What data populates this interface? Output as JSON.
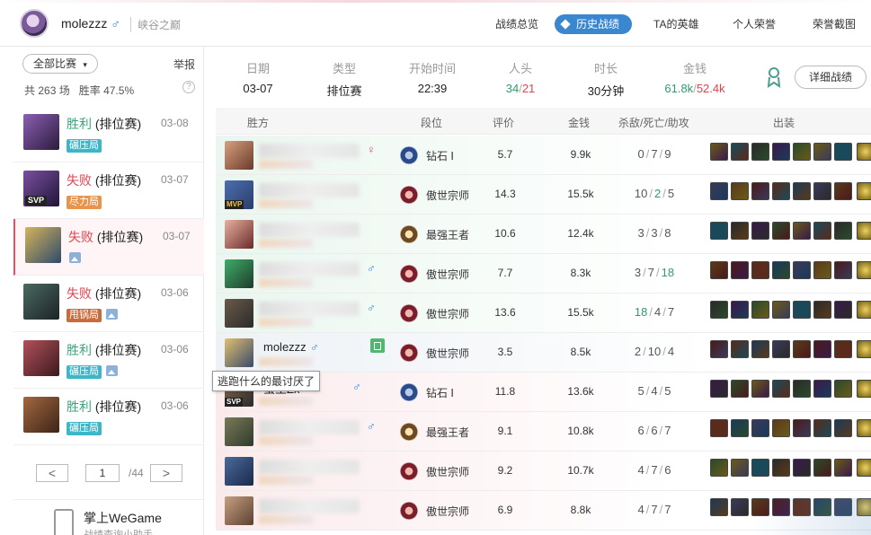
{
  "header": {
    "username": "molezzz",
    "gender_symbol": "♂",
    "server": "峡谷之巅",
    "nav": [
      "战绩总览",
      "历史战绩",
      "TA的英雄",
      "个人荣誉",
      "荣誉截图"
    ],
    "active_nav": "历史战绩"
  },
  "sidebar": {
    "filter_label": "全部比赛",
    "report_label": "举报",
    "total_prefix": "共",
    "total_games": "263",
    "total_suffix": "场",
    "winrate_label": "胜率",
    "winrate": "47.5%",
    "help": "?",
    "matches": [
      {
        "result": "胜利",
        "type": "(排位赛)",
        "date": "03-08",
        "tag": "碾压局",
        "tag_color": "#3cb6c8",
        "win": true,
        "pic": false,
        "svp": false
      },
      {
        "result": "失败",
        "type": "(排位赛)",
        "date": "03-07",
        "tag": "尽力局",
        "tag_color": "#e8944a",
        "win": false,
        "pic": false,
        "svp": true,
        "svp_label": "SVP"
      },
      {
        "result": "失败",
        "type": "(排位赛)",
        "date": "03-07",
        "tag": "",
        "tag_color": "",
        "win": false,
        "pic": true,
        "svp": false
      },
      {
        "result": "失败",
        "type": "(排位赛)",
        "date": "03-06",
        "tag": "甩锅局",
        "tag_color": "#c96b3b",
        "win": false,
        "pic": true,
        "svp": false
      },
      {
        "result": "胜利",
        "type": "(排位赛)",
        "date": "03-06",
        "tag": "碾压局",
        "tag_color": "#3cb6c8",
        "win": true,
        "pic": true,
        "svp": false
      },
      {
        "result": "胜利",
        "type": "(排位赛)",
        "date": "03-06",
        "tag": "碾压局",
        "tag_color": "#3cb6c8",
        "win": true,
        "pic": false,
        "svp": false
      }
    ],
    "pager": {
      "prev": "<",
      "current": "1",
      "total": "/44",
      "next": ">"
    },
    "mobile": {
      "title": "掌上WeGame",
      "subtitle": "战绩查询小助手"
    }
  },
  "summary": {
    "date_label": "日期",
    "date": "03-07",
    "type_label": "类型",
    "type": "排位赛",
    "start_label": "开始时间",
    "start": "22:39",
    "kills_label": "人头",
    "kills_a": "34",
    "kills_b": "21",
    "duration_label": "时长",
    "duration": "30分钟",
    "gold_label": "金钱",
    "gold_a": "61.8k",
    "gold_b": "52.4k",
    "detail_button": "详细战绩"
  },
  "table": {
    "headers": [
      "胜方",
      "段位",
      "评价",
      "金钱",
      "杀敌/死亡/助攻",
      "出装"
    ],
    "rows": [
      {
        "name": "",
        "gender": "♀",
        "rank": "钻石 Ⅰ",
        "rank_tier": "dia",
        "score": "5.7",
        "money": "9.9k",
        "k": "0",
        "d": "7",
        "a": "9",
        "side": "win",
        "score_hl": false,
        "money_hl": false,
        "a_hl": false,
        "k_hl": false,
        "d_hl": false
      },
      {
        "name": "",
        "gender": "",
        "rank": "傲世宗师",
        "rank_tier": "gm",
        "score": "14.3",
        "money": "15.5k",
        "k": "10",
        "d": "2",
        "a": "5",
        "side": "win",
        "score_hl": true,
        "money_hl": true,
        "d_hl": true,
        "mvp": "MVP"
      },
      {
        "name": "",
        "gender": "",
        "rank": "最强王者",
        "rank_tier": "ch",
        "score": "10.6",
        "money": "12.4k",
        "k": "3",
        "d": "3",
        "a": "8",
        "side": "win"
      },
      {
        "name": "",
        "gender": "♂",
        "rank": "傲世宗师",
        "rank_tier": "gm",
        "score": "7.7",
        "money": "8.3k",
        "k": "3",
        "d": "7",
        "a": "18",
        "side": "win",
        "a_hl": true
      },
      {
        "name": "",
        "gender": "♂",
        "rank": "傲世宗师",
        "rank_tier": "gm",
        "score": "13.6",
        "money": "15.5k",
        "k": "18",
        "d": "4",
        "a": "7",
        "side": "win",
        "k_hl": true
      },
      {
        "name": "molezzz",
        "gender": "♂",
        "rank": "傲世宗师",
        "rank_tier": "gm",
        "score": "3.5",
        "money": "8.5k",
        "k": "2",
        "d": "10",
        "a": "4",
        "side": "me"
      },
      {
        "name": "蛮王Zx",
        "gender": "♂",
        "rank": "钻石 Ⅰ",
        "rank_tier": "dia",
        "score": "11.8",
        "money": "13.6k",
        "k": "5",
        "d": "4",
        "a": "5",
        "side": "lose",
        "svp": "SVP"
      },
      {
        "name": "",
        "gender": "♂",
        "rank": "最强王者",
        "rank_tier": "ch",
        "score": "9.1",
        "money": "10.8k",
        "k": "6",
        "d": "6",
        "a": "7",
        "side": "lose"
      },
      {
        "name": "",
        "gender": "",
        "rank": "傲世宗师",
        "rank_tier": "gm",
        "score": "9.2",
        "money": "10.7k",
        "k": "4",
        "d": "7",
        "a": "6",
        "side": "lose"
      },
      {
        "name": "",
        "gender": "",
        "rank": "傲世宗师",
        "rank_tier": "gm",
        "score": "6.9",
        "money": "8.8k",
        "k": "4",
        "d": "7",
        "a": "7",
        "side": "lose"
      }
    ],
    "tooltip": "逃跑什么的最讨厌了"
  },
  "colors": {
    "accent": "#3a86cf",
    "win": "#3aa57a",
    "lose": "#e2424f"
  }
}
